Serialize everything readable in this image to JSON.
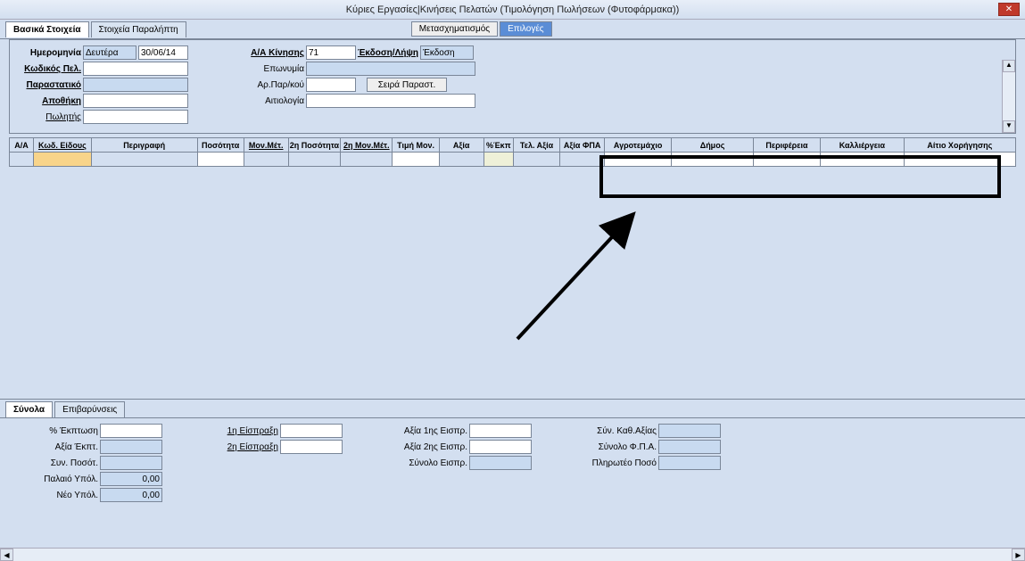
{
  "window": {
    "title": "Κύριες Εργασίες|Κινήσεις Πελατών (Τιμολόγηση Πωλήσεων (Φυτοφάρμακα))",
    "close": "✕"
  },
  "tabs": {
    "basic": "Βασικά Στοιχεία",
    "recipient": "Στοιχεία Παραλήπτη"
  },
  "toolbar": {
    "transform": "Μετασχηματισμός",
    "options": "Επιλογές"
  },
  "form": {
    "date_label": "Ημερομηνία",
    "day": "Δευτέρα",
    "date": "30/06/14",
    "customer_code_label": "Κωδικός Πελ.",
    "doc_label": "Παραστατικό",
    "warehouse_label": "Αποθήκη",
    "seller_label": "Πωλητής",
    "aa_label": "Α/Α Κίνησης",
    "aa_val": "71",
    "issue_label": "Έκδοση/Λήψη",
    "issue_val": "Έκδοση",
    "name_label": "Επωνυμία",
    "receipt_label": "Αρ.Παρ/κού",
    "series_btn": "Σειρά Παραστ.",
    "reason_label": "Αιτιολογία"
  },
  "grid": {
    "h_aa": "Α/Α",
    "h_code": "Κωδ. Είδους",
    "h_desc": "Περιγραφή",
    "h_qty": "Ποσότητα",
    "h_unit": "Μον.Μέτ.",
    "h_qty2": "2η Ποσότητα",
    "h_unit2": "2η Μον.Μέτ.",
    "h_price": "Τιμή Μον.",
    "h_value": "Αξία",
    "h_disc": "%Έκπ",
    "h_final": "Τελ. Αξία",
    "h_vat": "Αξία ΦΠΑ",
    "h_plot": "Αγροτεμάχιο",
    "h_muni": "Δήμος",
    "h_region": "Περιφέρεια",
    "h_crop": "Καλλιέργεια",
    "h_cause": "Αίτιο Χορήγησης"
  },
  "btabs": {
    "totals": "Σύνολα",
    "charges": "Επιβαρύνσεις"
  },
  "totals": {
    "disc_pct": "% Έκπτωση",
    "disc_val": "Αξία Έκπτ.",
    "sum_qty": "Συν. Ποσότ.",
    "old_bal": "Παλαιό Υπόλ.",
    "old_bal_v": "0,00",
    "new_bal": "Νέο Υπόλ.",
    "new_bal_v": "0,00",
    "pay1": "1η Είσπραξη",
    "pay2": "2η Είσπραξη",
    "val1": "Αξία 1ης Εισπρ.",
    "val2": "Αξία 2ης Εισπρ.",
    "sum_col": "Σύνολο Εισπρ.",
    "net": "Σύν. Καθ.Αξίας",
    "vat": "Σύνολο Φ.Π.Α.",
    "payable": "Πληρωτέο Ποσό"
  }
}
